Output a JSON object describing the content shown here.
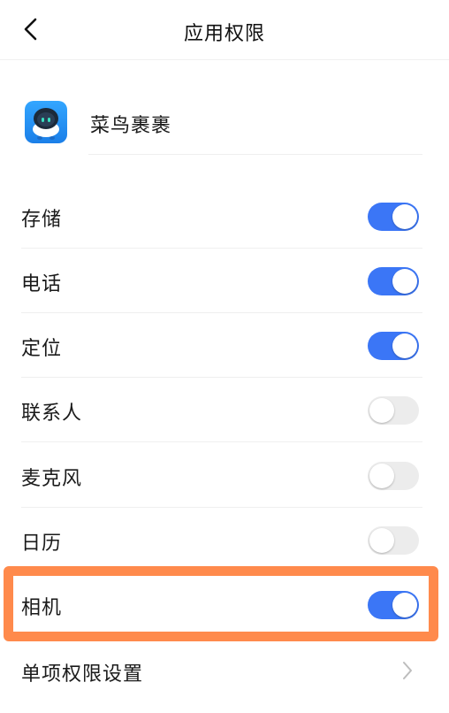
{
  "header": {
    "title": "应用权限",
    "back_icon": "chevron-left-icon"
  },
  "app": {
    "name": "菜鸟裹裹",
    "icon": "cainiao-robot-icon",
    "icon_color": "#2b96f7"
  },
  "permissions": [
    {
      "label": "存储",
      "enabled": true
    },
    {
      "label": "电话",
      "enabled": true
    },
    {
      "label": "定位",
      "enabled": true
    },
    {
      "label": "联系人",
      "enabled": false
    },
    {
      "label": "麦克风",
      "enabled": false
    },
    {
      "label": "日历",
      "enabled": false
    },
    {
      "label": "相机",
      "enabled": true,
      "highlighted": true
    }
  ],
  "single_settings": {
    "label": "单项权限设置",
    "icon": "chevron-right-icon"
  },
  "colors": {
    "toggle_on": "#3b76f6",
    "toggle_off": "#ececec",
    "highlight": "#ff8a4c"
  }
}
